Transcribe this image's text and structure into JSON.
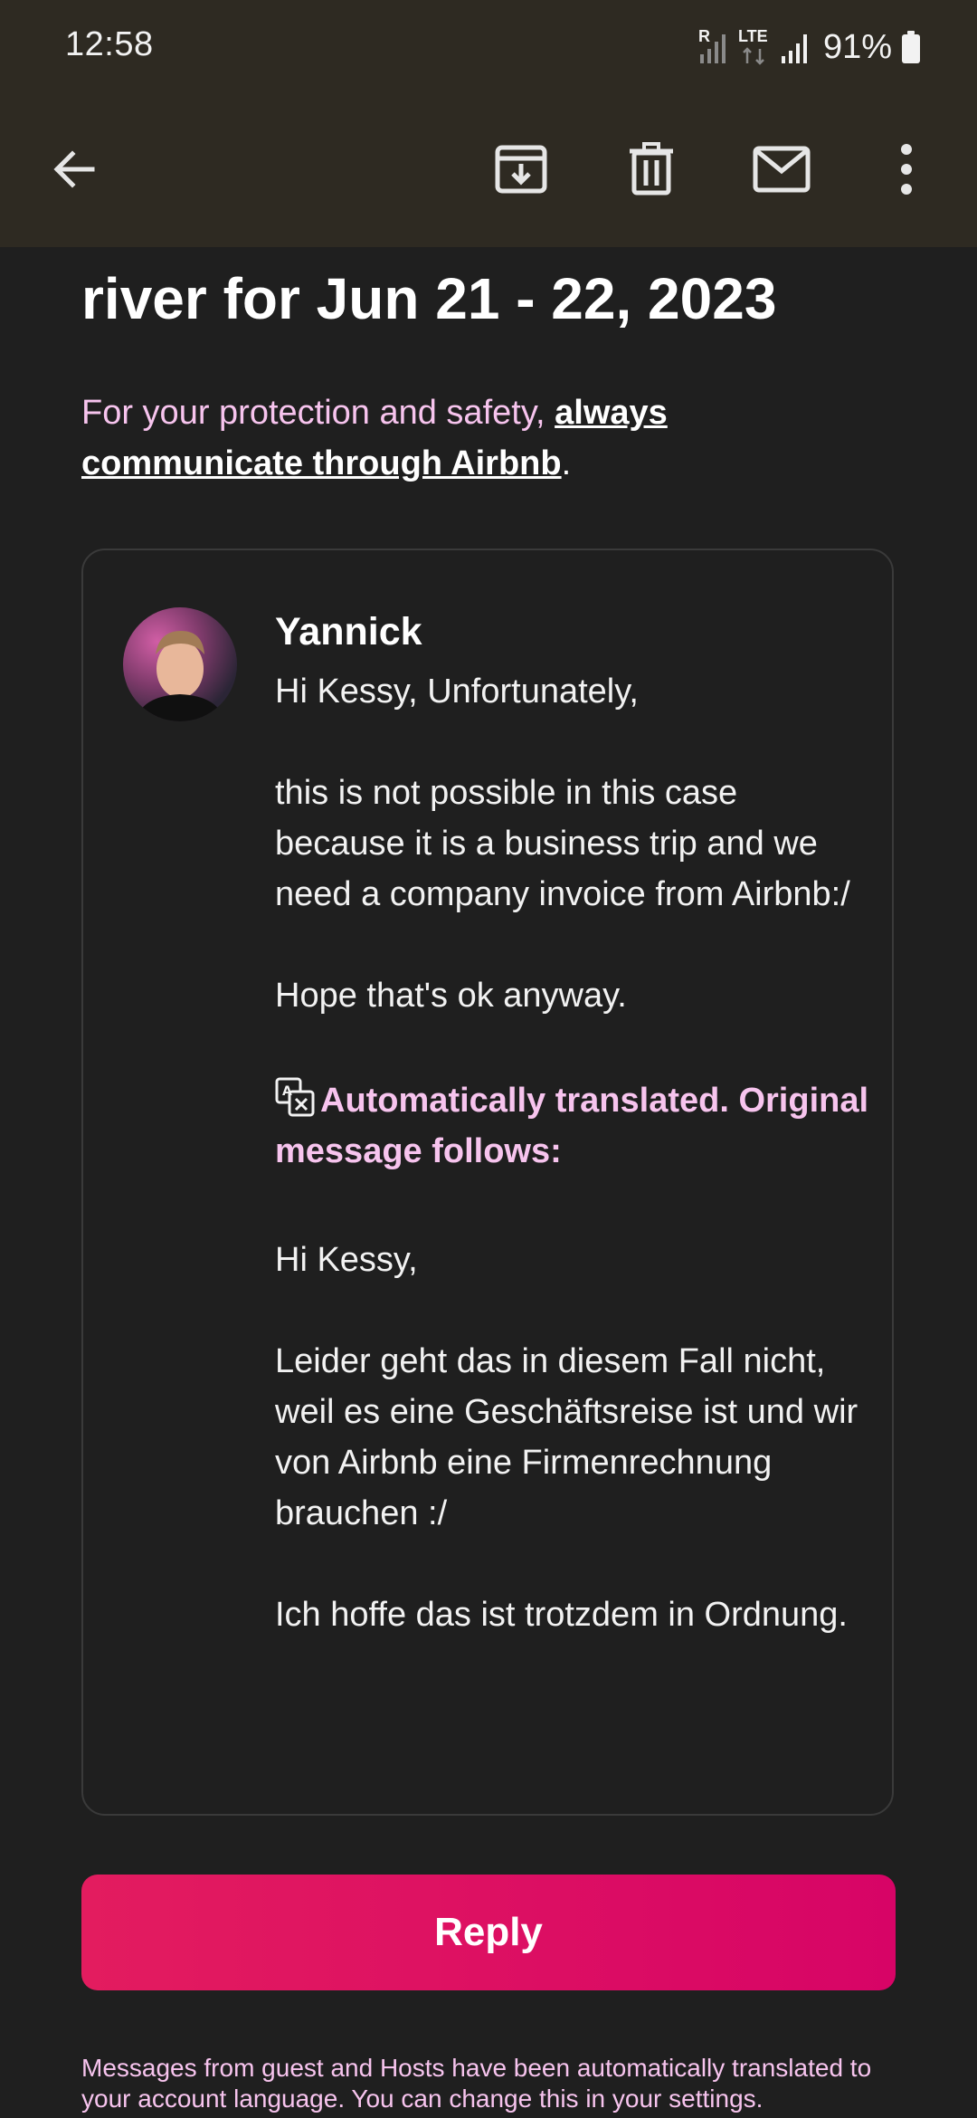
{
  "status_bar": {
    "time": "12:58",
    "roaming_label": "R",
    "network_label": "LTE",
    "battery": "91%"
  },
  "toolbar": {
    "back": "back-icon",
    "archive": "archive-icon",
    "delete": "trash-icon",
    "mark_unread": "mail-icon",
    "more": "more-vert-icon"
  },
  "email": {
    "headline": "river for Jun 21 - 22, 2023",
    "protection_prefix": "For your protection and safety, ",
    "protection_link": "always communicate through Airbnb",
    "protection_suffix": "."
  },
  "message": {
    "sender": "Yannick",
    "paragraphs": [
      "Hi Kessy, Unfortunately,",
      "this is not possible in this case because it is a business trip and we need a company invoice from Airbnb:/",
      "Hope that's ok anyway."
    ],
    "translated_notice": "Automatically translated. Original message follows:",
    "original_paragraphs": [
      "Hi Kessy,",
      "Leider geht das in diesem Fall nicht, weil es eine Geschäftsreise ist und wir von Airbnb eine Firmenrechnung brauchen :/",
      "Ich hoffe das ist trotzdem in Ordnung."
    ]
  },
  "reply_button": "Reply",
  "footnote": "Messages from guest and Hosts have been automatically translated to your account language. You can change this in your settings.",
  "colors": {
    "accent_pink": "#f7c4ee",
    "reply_gradient_start": "#e31c5f",
    "reply_gradient_end": "#d70466",
    "toolbar_bg": "#2e2a22",
    "page_bg": "#1f1f1f"
  }
}
